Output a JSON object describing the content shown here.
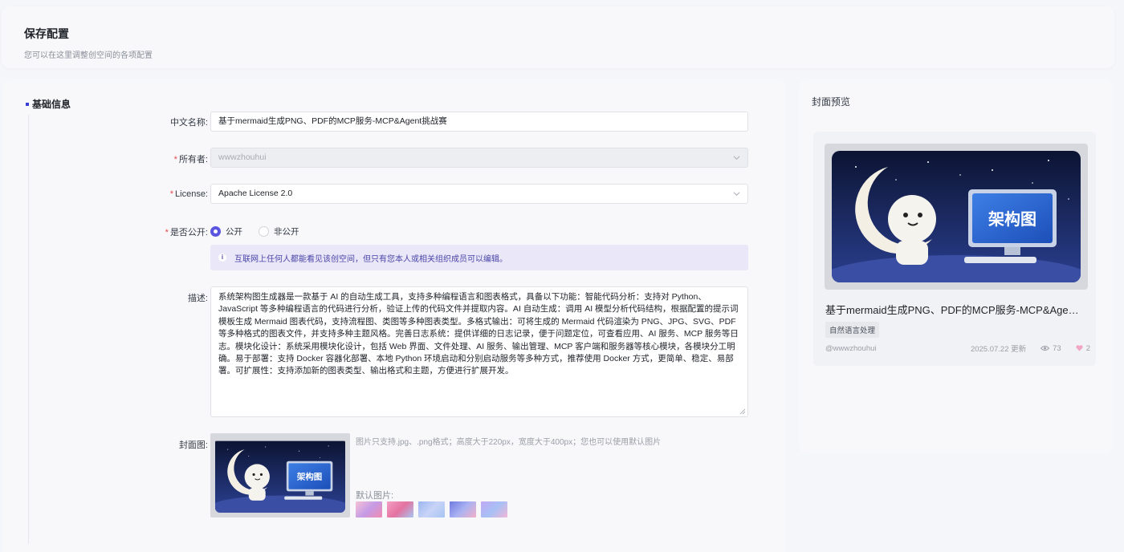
{
  "header": {
    "title": "保存配置",
    "subtitle": "您可以在这里调整创空间的各项配置"
  },
  "form": {
    "section_title": "基础信息",
    "name": {
      "label": "中文名称:",
      "value": "基于mermaid生成PNG、PDF的MCP服务-MCP&Agent挑战赛"
    },
    "owner": {
      "label": "所有者:",
      "value": "wwwzhouhui"
    },
    "license": {
      "label": "License:",
      "value": "Apache License 2.0"
    },
    "public": {
      "label": "是否公开:",
      "option_public": "公开",
      "option_private": "非公开",
      "selected": "公开"
    },
    "public_info": "互联网上任何人都能看见该创空间，但只有您本人或相关组织成员可以编辑。",
    "description": {
      "label": "描述:",
      "value": "系统架构图生成器是一款基于 AI 的自动生成工具，支持多种编程语言和图表格式，具备以下功能：智能代码分析：支持对 Python、JavaScript 等多种编程语言的代码进行分析，验证上传的代码文件并提取内容。AI 自动生成：调用 AI 模型分析代码结构，根据配置的提示词模板生成 Mermaid 图表代码，支持流程图、类图等多种图表类型。多格式输出：可将生成的 Mermaid 代码渲染为 PNG、JPG、SVG、PDF 等多种格式的图表文件，并支持多种主题风格。完善日志系统：提供详细的日志记录，便于问题定位，可查看应用、AI 服务、MCP 服务等日志。模块化设计：系统采用模块化设计，包括 Web 界面、文件处理、AI 服务、输出管理、MCP 客户端和服务器等核心模块，各模块分工明确。易于部署：支持 Docker 容器化部署、本地 Python 环境启动和分别启动服务等多种方式，推荐使用 Docker 方式，更简单、稳定、易部署。可扩展性：支持添加新的图表类型、输出格式和主题，方便进行扩展开发。"
    },
    "cover": {
      "label": "封面图:",
      "image_text": "架构图",
      "hint": "图片只支持.jpg、.png格式；高度大于220px，宽度大于400px；您也可以使用默认图片",
      "default_label": "默认图片:",
      "defaults": [
        "#e9a7c7",
        "#f08bb0",
        "#a9b8ef",
        "#8f8fe6",
        "#c6b6f2"
      ]
    }
  },
  "preview": {
    "title": "封面预览",
    "card": {
      "image_text": "架构图",
      "title": "基于mermaid生成PNG、PDF的MCP服务-MCP&Agent挑战赛",
      "tag": "自然语言处理",
      "author": "@wwwzhouhui",
      "date": "2025.07.22 更新",
      "views": "73",
      "likes": "2"
    }
  },
  "colors": {
    "accent": "#5a55e0",
    "required": "#e5484d",
    "info_bg": "#e9e7f8"
  }
}
